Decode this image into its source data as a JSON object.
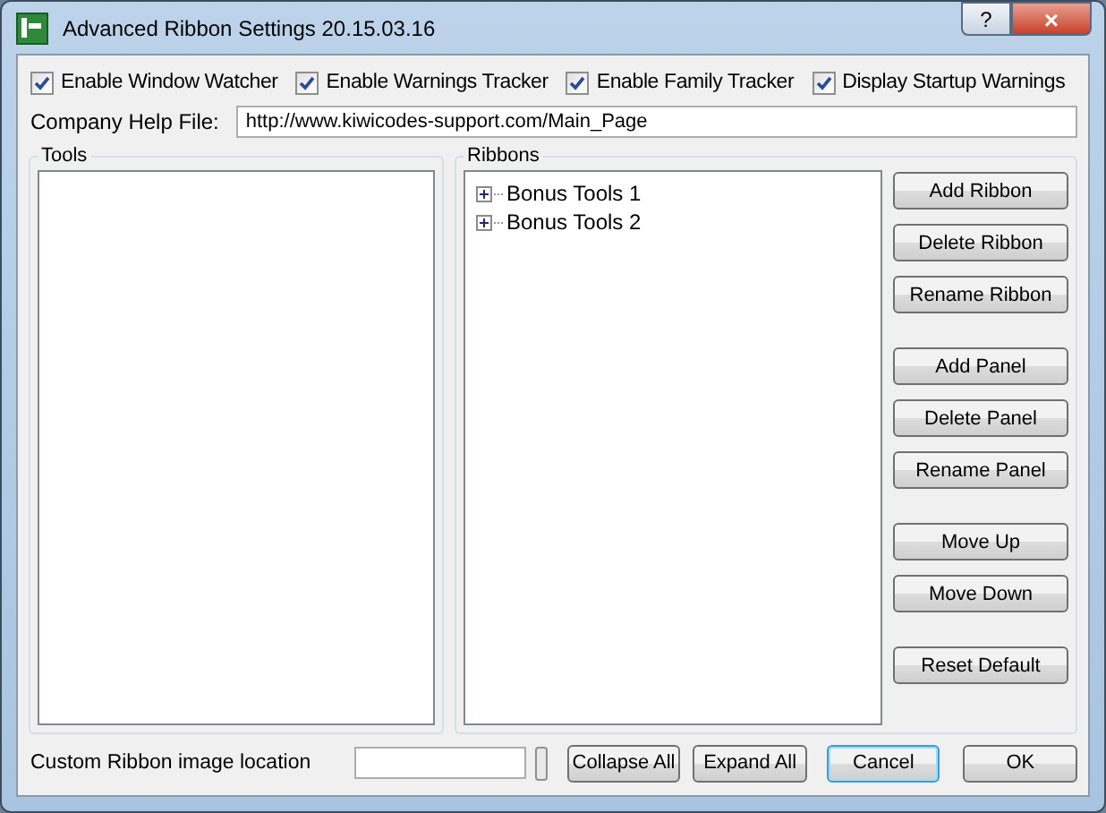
{
  "window": {
    "title": "Advanced Ribbon Settings 20.15.03.16",
    "help_button": "?",
    "close_button": "×"
  },
  "checkboxes": [
    {
      "label": "Enable Window Watcher",
      "checked": true
    },
    {
      "label": "Enable Warnings Tracker",
      "checked": true
    },
    {
      "label": "Enable Family Tracker",
      "checked": true
    },
    {
      "label": "Display Startup Warnings",
      "checked": true
    }
  ],
  "help_file": {
    "label": "Company Help File:",
    "value": "http://www.kiwicodes-support.com/Main_Page"
  },
  "tools": {
    "title": "Tools"
  },
  "ribbons": {
    "title": "Ribbons",
    "items": [
      {
        "label": "Bonus Tools 1",
        "expanded": false
      },
      {
        "label": "Bonus Tools 2",
        "expanded": false
      }
    ]
  },
  "side_buttons": [
    [
      "Add Ribbon",
      "Delete Ribbon",
      "Rename Ribbon"
    ],
    [
      "Add Panel",
      "Delete Panel",
      "Rename Panel"
    ],
    [
      "Move Up",
      "Move Down"
    ],
    [
      "Reset Default"
    ]
  ],
  "image_location": {
    "label": "Custom Ribbon image location"
  },
  "bottom_buttons": [
    {
      "label": "Collapse All",
      "focused": false
    },
    {
      "label": "Expand All",
      "focused": false
    },
    {
      "label": "Cancel",
      "focused": true
    },
    {
      "label": "OK",
      "focused": false
    }
  ]
}
